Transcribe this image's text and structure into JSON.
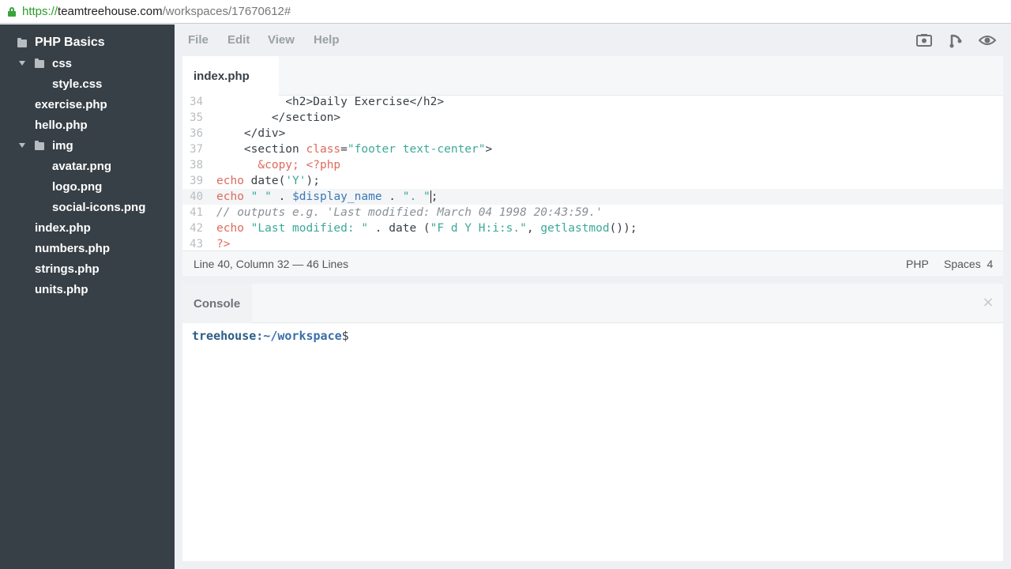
{
  "browser": {
    "url_scheme": "https://",
    "url_host": "teamtreehouse.com",
    "url_path": "/workspaces/17670612#"
  },
  "sidebar": {
    "project": "PHP Basics",
    "items": [
      {
        "label": "css",
        "type": "folder"
      },
      {
        "label": "style.css",
        "type": "file"
      },
      {
        "label": "exercise.php",
        "type": "file"
      },
      {
        "label": "hello.php",
        "type": "file"
      },
      {
        "label": "img",
        "type": "folder"
      },
      {
        "label": "avatar.png",
        "type": "file"
      },
      {
        "label": "logo.png",
        "type": "file"
      },
      {
        "label": "social-icons.png",
        "type": "file"
      },
      {
        "label": "index.php",
        "type": "file"
      },
      {
        "label": "numbers.php",
        "type": "file"
      },
      {
        "label": "strings.php",
        "type": "file"
      },
      {
        "label": "units.php",
        "type": "file"
      }
    ]
  },
  "menu": {
    "file": "File",
    "edit": "Edit",
    "view": "View",
    "help": "Help"
  },
  "toolbar": {
    "icons": [
      "camera-icon",
      "fork-icon",
      "eye-icon"
    ]
  },
  "editor": {
    "tab": "index.php",
    "active_line": "40",
    "lines": [
      {
        "n": "34",
        "tokens": [
          [
            "t-plain",
            "          "
          ],
          [
            "t-tag",
            "<h2>Daily Exercise</h2>"
          ]
        ]
      },
      {
        "n": "35",
        "tokens": [
          [
            "t-plain",
            "        "
          ],
          [
            "t-tag",
            "</section>"
          ]
        ]
      },
      {
        "n": "36",
        "tokens": [
          [
            "t-plain",
            "    "
          ],
          [
            "t-tag",
            "</div>"
          ]
        ]
      },
      {
        "n": "37",
        "tokens": [
          [
            "t-plain",
            "    "
          ],
          [
            "t-tag",
            "<section "
          ],
          [
            "t-attr",
            "class"
          ],
          [
            "t-plain",
            "="
          ],
          [
            "t-str",
            "\"footer text-center\""
          ],
          [
            "t-tag",
            ">"
          ]
        ]
      },
      {
        "n": "38",
        "tokens": [
          [
            "t-plain",
            "      "
          ],
          [
            "t-attr",
            "&copy;"
          ],
          [
            "t-plain",
            " "
          ],
          [
            "t-php",
            "<?php"
          ]
        ]
      },
      {
        "n": "39",
        "tokens": [
          [
            "t-kw",
            "echo"
          ],
          [
            "t-plain",
            " date("
          ],
          [
            "t-str",
            "'Y'"
          ],
          [
            "t-plain",
            ");"
          ]
        ]
      },
      {
        "n": "40",
        "tokens": [
          [
            "t-kw",
            "echo"
          ],
          [
            "t-plain",
            " "
          ],
          [
            "t-str",
            "\" \""
          ],
          [
            "t-plain",
            " . "
          ],
          [
            "t-var",
            "$display_name"
          ],
          [
            "t-plain",
            " . "
          ],
          [
            "t-str",
            "\". \""
          ],
          [
            "cursor",
            ""
          ],
          [
            "t-plain",
            ";"
          ]
        ]
      },
      {
        "n": "41",
        "tokens": [
          [
            "t-com",
            "// outputs e.g. 'Last modified: March 04 1998 20:43:59.'"
          ]
        ]
      },
      {
        "n": "42",
        "tokens": [
          [
            "t-kw",
            "echo"
          ],
          [
            "t-plain",
            " "
          ],
          [
            "t-str",
            "\"Last modified: \""
          ],
          [
            "t-plain",
            " . date ("
          ],
          [
            "t-str",
            "\"F d Y H:i:s.\""
          ],
          [
            "t-plain",
            ", "
          ],
          [
            "t-fn",
            "getlastmod"
          ],
          [
            "t-plain",
            "());"
          ]
        ]
      },
      {
        "n": "43",
        "tokens": [
          [
            "t-php",
            "?>"
          ]
        ]
      }
    ]
  },
  "status": {
    "position": "Line 40, Column 32 — 46 Lines",
    "language": "PHP",
    "indent": "Spaces  4"
  },
  "console": {
    "tab": "Console",
    "close_glyph": "×",
    "prompt_user": "treehouse",
    "prompt_path": ":~/workspace",
    "prompt_symbol": "$"
  }
}
